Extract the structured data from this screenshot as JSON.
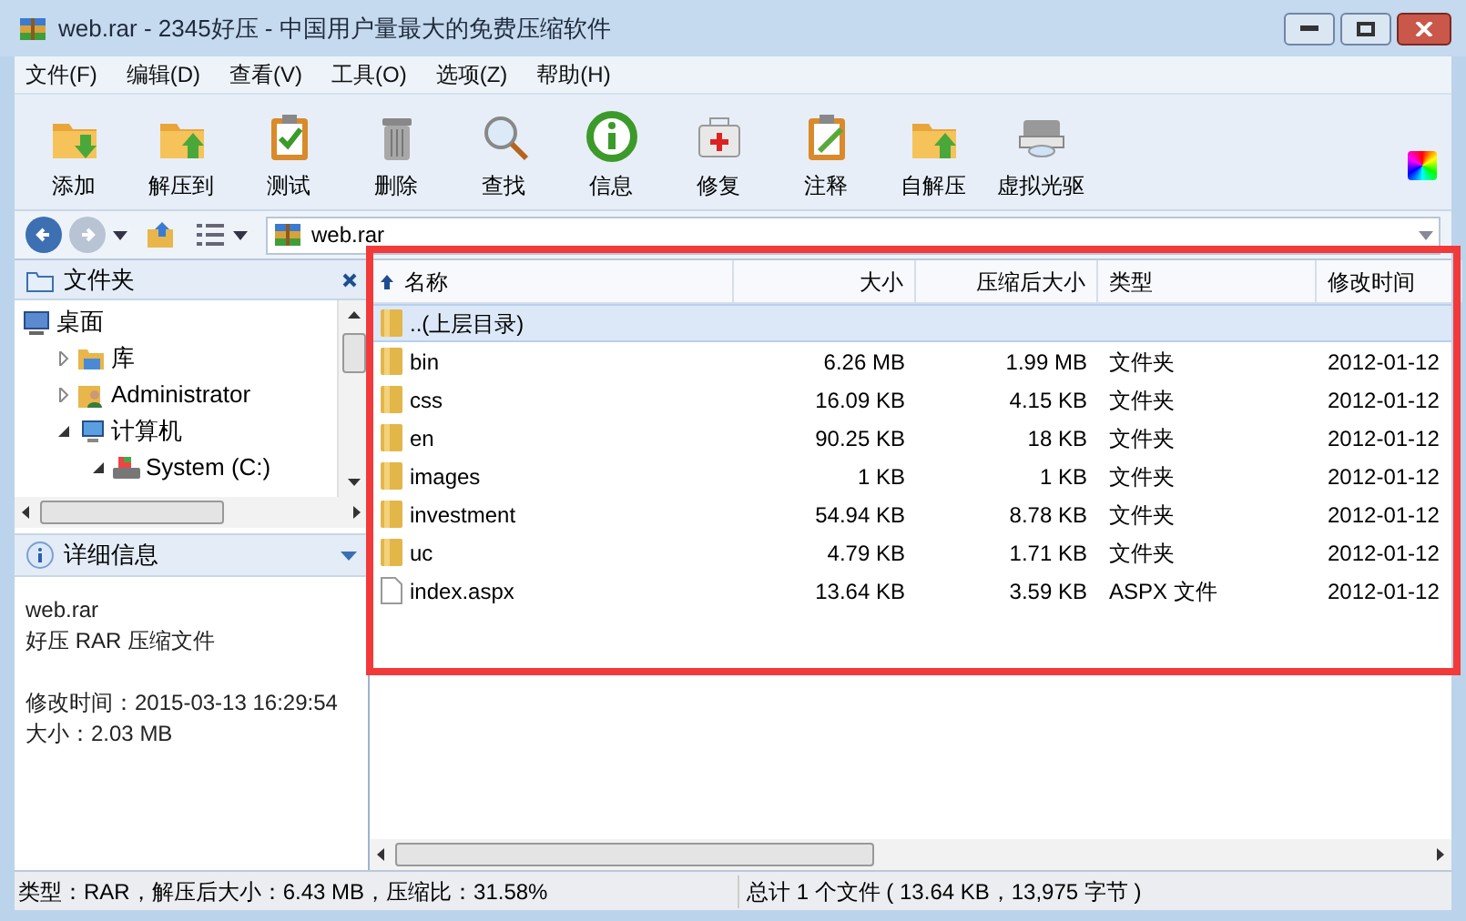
{
  "window": {
    "title": "web.rar - 2345好压 - 中国用户量最大的免费压缩软件"
  },
  "menu": [
    "文件(F)",
    "编辑(D)",
    "查看(V)",
    "工具(O)",
    "选项(Z)",
    "帮助(H)"
  ],
  "toolbar": [
    {
      "label": "添加",
      "kind": "folder-down"
    },
    {
      "label": "解压到",
      "kind": "folder-up"
    },
    {
      "label": "测试",
      "kind": "clipboard-check"
    },
    {
      "label": "删除",
      "kind": "trash"
    },
    {
      "label": "查找",
      "kind": "magnifier"
    },
    {
      "label": "信息",
      "kind": "info"
    },
    {
      "label": "修复",
      "kind": "medkit"
    },
    {
      "label": "注释",
      "kind": "clipboard-pencil"
    },
    {
      "label": "自解压",
      "kind": "folder-up"
    },
    {
      "label": "虚拟光驱",
      "kind": "drive"
    }
  ],
  "address": {
    "value": "web.rar"
  },
  "folders_pane": {
    "title": "文件夹",
    "tree": [
      {
        "label": "桌面",
        "kind": "desktop",
        "children": [
          {
            "label": "库",
            "kind": "library",
            "expanded": false
          },
          {
            "label": "Administrator",
            "kind": "user",
            "expanded": false
          },
          {
            "label": "计算机",
            "kind": "computer",
            "expanded": true,
            "children": [
              {
                "label": "System (C:)",
                "kind": "drive",
                "expanded": true
              }
            ]
          }
        ]
      }
    ]
  },
  "details_pane": {
    "title": "详细信息",
    "groups": [
      [
        "web.rar",
        "好压 RAR 压缩文件"
      ],
      [
        "修改时间：2015-03-13 16:29:54",
        "大小：2.03 MB"
      ]
    ]
  },
  "table": {
    "columns": [
      "名称",
      "大小",
      "压缩后大小",
      "类型",
      "修改时间"
    ],
    "rows": [
      {
        "kind": "folder",
        "selected": true,
        "cells": [
          "..(上层目录)"
        ]
      },
      {
        "kind": "folder",
        "selected": false,
        "cells": [
          "bin",
          "6.26 MB",
          "1.99 MB",
          "文件夹",
          "2012-01-12"
        ]
      },
      {
        "kind": "folder",
        "selected": false,
        "cells": [
          "css",
          "16.09 KB",
          "4.15 KB",
          "文件夹",
          "2012-01-12"
        ]
      },
      {
        "kind": "folder",
        "selected": false,
        "cells": [
          "en",
          "90.25 KB",
          "18 KB",
          "文件夹",
          "2012-01-12"
        ]
      },
      {
        "kind": "folder",
        "selected": false,
        "cells": [
          "images",
          "1 KB",
          "1 KB",
          "文件夹",
          "2012-01-12"
        ]
      },
      {
        "kind": "folder",
        "selected": false,
        "cells": [
          "investment",
          "54.94 KB",
          "8.78 KB",
          "文件夹",
          "2012-01-12"
        ]
      },
      {
        "kind": "folder",
        "selected": false,
        "cells": [
          "uc",
          "4.79 KB",
          "1.71 KB",
          "文件夹",
          "2012-01-12"
        ]
      },
      {
        "kind": "file",
        "selected": false,
        "cells": [
          "index.aspx",
          "13.64 KB",
          "3.59 KB",
          "ASPX 文件",
          "2012-01-12"
        ]
      }
    ]
  },
  "status_bar": [
    "类型：RAR，解压后大小：6.43 MB，压缩比：31.58%",
    "总计 1 个文件 ( 13.64 KB，13,975 字节 )"
  ]
}
